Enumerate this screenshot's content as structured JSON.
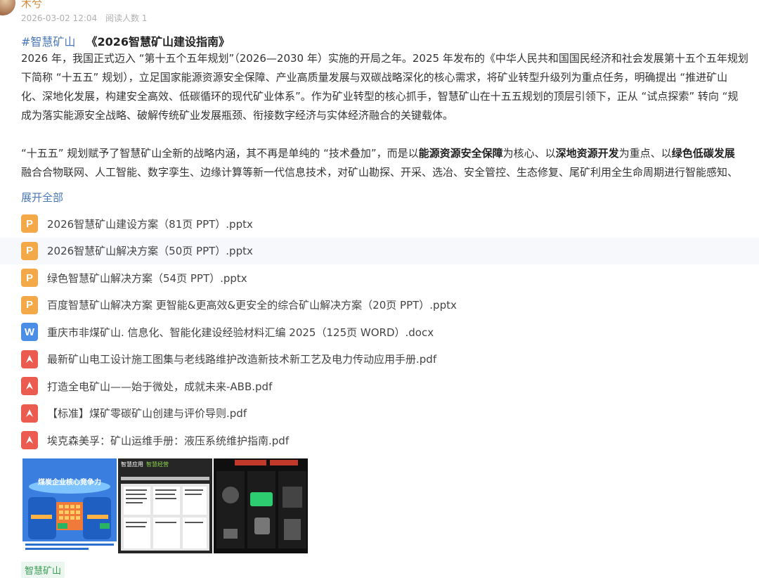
{
  "post": {
    "author": "木兮",
    "date": "2026-03-02 12:04",
    "reads": "阅读人数 1",
    "tag": "#智慧矿山",
    "title": "《2026智慧矿山建设指南》",
    "para1": [
      "2026 年，我国正式迈入 “第十五个五年规划”（2026—2030 年）实施的开局之年。2025 年发布的《中华人民共和国国民经济和社会发展第十五个五年规划",
      "下简称 “十五五” 规划），立足国家能源资源安全保障、产业高质量发展与双碳战略深化的核心需求，将矿业转型升级列为重点任务，明确提出 “推进矿山",
      "化、深地化发展，构建安全高效、低碳循环的现代矿业体系”。作为矿业转型的核心抓手，智慧矿山在十五五规划的顶层引领下，正从 “试点探索” 转向 “规",
      "成为落实能源安全战略、破解传统矿业发展瓶颈、衔接数字经济与实体经济融合的关键载体。"
    ],
    "para2_a": "“十五五” 规划赋予了智慧矿山全新的战略内涵，其不再是单纯的 “技术叠加”，而是以",
    "para2_b1": "能源资源安全保障",
    "para2_c": "为核心、以",
    "para2_b2": "深地资源开发",
    "para2_d": "为重点、以",
    "para2_b3": "绿色低碳发展",
    "para2_line2": "融合合物联网、人工智能、数字孪生、边缘计算等新一代信息技术，对矿山勘探、开采、选冶、安全管控、生态修复、尾矿利用全生命周期进行智能感知、",
    "expand": "展开全部",
    "bottom_tag": "智慧矿山"
  },
  "attachments": [
    {
      "type": "ppt",
      "icon": "ppt-file-icon",
      "letter": "P",
      "name": "2026智慧矿山建设方案（81页 PPT）.pptx"
    },
    {
      "type": "ppt",
      "icon": "ppt-file-icon",
      "letter": "P",
      "name": "2026智慧矿山解决方案（50页 PPT）.pptx"
    },
    {
      "type": "ppt",
      "icon": "ppt-file-icon",
      "letter": "P",
      "name": "绿色智慧矿山解决方案（54页 PPT）.pptx"
    },
    {
      "type": "ppt",
      "icon": "ppt-file-icon",
      "letter": "P",
      "name": "百度智慧矿山解决方案 更智能&更高效&更安全的综合矿山解决方案（20页 PPT）.pptx"
    },
    {
      "type": "doc",
      "icon": "word-file-icon",
      "letter": "W",
      "name": "重庆市非煤矿山. 信息化、智能化建设经验材料汇编 2025（125页 WORD）.docx"
    },
    {
      "type": "pdf",
      "icon": "pdf-file-icon",
      "letter": "",
      "name": "最新矿山电工设计施工图集与老线路维护改造新技术新工艺及电力传动应用手册.pdf"
    },
    {
      "type": "pdf",
      "icon": "pdf-file-icon",
      "letter": "",
      "name": "打造全电矿山——始于微处，成就未来-ABB.pdf"
    },
    {
      "type": "pdf",
      "icon": "pdf-file-icon",
      "letter": "",
      "name": "【标准】煤矿零碳矿山创建与评价导则.pdf"
    },
    {
      "type": "pdf",
      "icon": "pdf-file-icon",
      "letter": "",
      "name": "埃克森美孚：矿山运维手册：液压系统维护指南.pdf"
    }
  ],
  "thumbnails": {
    "t1_title": "煤炭企业核心竞争力",
    "t2_title": "智慧应用",
    "t2_sub": "智慧经营"
  }
}
